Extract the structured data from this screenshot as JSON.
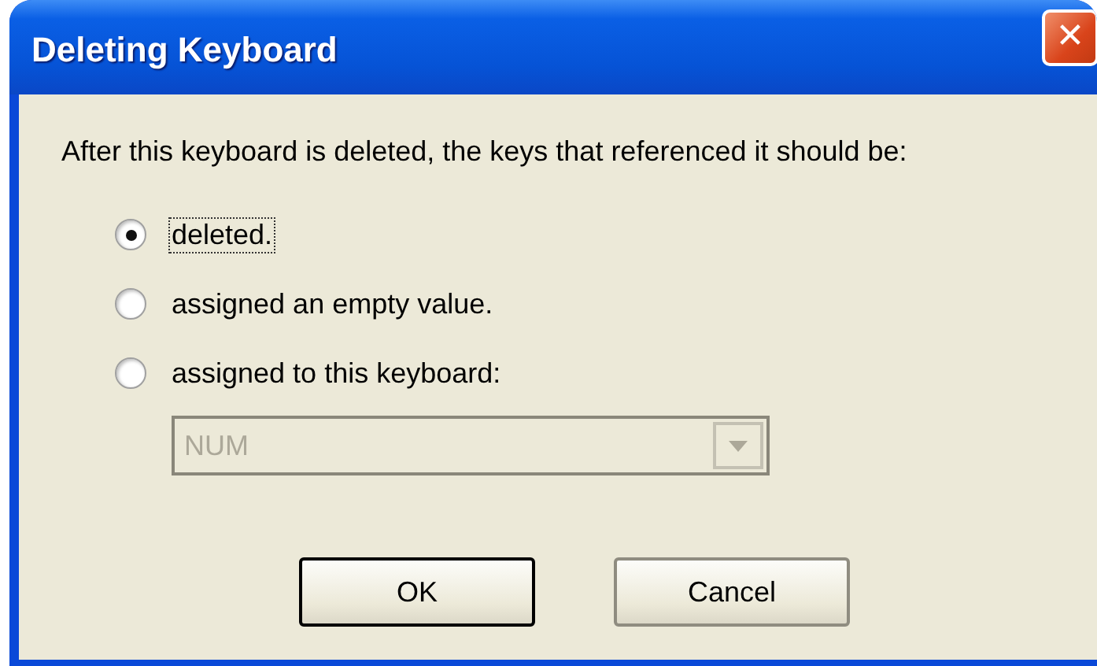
{
  "window": {
    "title": "Deleting Keyboard",
    "close_button": "✕"
  },
  "prompt": "After this keyboard is deleted, the keys that referenced it should be:",
  "options": [
    {
      "label": "deleted.",
      "selected": true,
      "focused": true
    },
    {
      "label": "assigned an empty value.",
      "selected": false,
      "focused": false
    },
    {
      "label": "assigned to this keyboard:",
      "selected": false,
      "focused": false
    }
  ],
  "keyboard_select": {
    "value": "NUM",
    "disabled": true
  },
  "buttons": [
    {
      "label": "OK",
      "default": true
    },
    {
      "label": "Cancel",
      "default": false
    }
  ]
}
